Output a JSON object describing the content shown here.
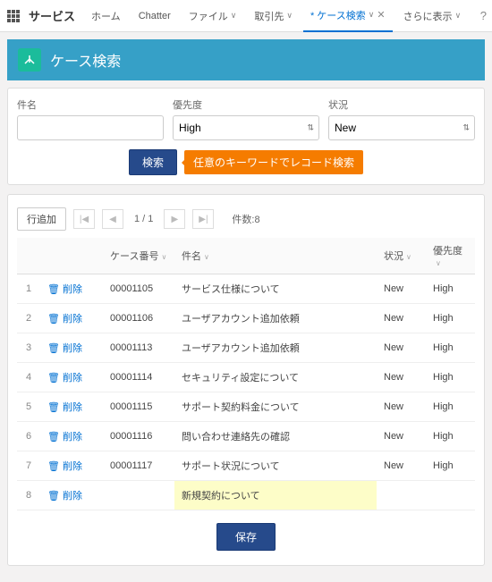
{
  "nav": {
    "app": "サービス",
    "items": [
      "ホーム",
      "Chatter",
      "ファイル",
      "取引先",
      "* ケース検索",
      "さらに表示"
    ],
    "dropdown_idx": [
      2,
      3,
      4,
      5
    ],
    "active_idx": 4
  },
  "header": {
    "title": "ケース検索",
    "icon_glyph": "⬍"
  },
  "filters": {
    "subject_label": "件名",
    "subject_value": "",
    "priority_label": "優先度",
    "priority_value": "High",
    "status_label": "状況",
    "status_value": "New"
  },
  "actions": {
    "search": "検索",
    "callout": "任意のキーワードでレコード検索",
    "add_row": "行追加",
    "save": "保存"
  },
  "pager": {
    "page_text": "1 / 1",
    "count_text": "件数:8"
  },
  "columns": {
    "case_no": "ケース番号",
    "subject": "件名",
    "status": "状況",
    "priority": "優先度"
  },
  "delete_label": "削除",
  "rows": [
    {
      "idx": "1",
      "case": "00001105",
      "subject": "サービス仕様について",
      "status": "New",
      "priority": "High"
    },
    {
      "idx": "2",
      "case": "00001106",
      "subject": "ユーザアカウント追加依頼",
      "status": "New",
      "priority": "High"
    },
    {
      "idx": "3",
      "case": "00001113",
      "subject": "ユーザアカウント追加依頼",
      "status": "New",
      "priority": "High"
    },
    {
      "idx": "4",
      "case": "00001114",
      "subject": "セキュリティ設定について",
      "status": "New",
      "priority": "High"
    },
    {
      "idx": "5",
      "case": "00001115",
      "subject": "サポート契約料金について",
      "status": "New",
      "priority": "High"
    },
    {
      "idx": "6",
      "case": "00001116",
      "subject": "問い合わせ連絡先の確認",
      "status": "New",
      "priority": "High"
    },
    {
      "idx": "7",
      "case": "00001117",
      "subject": "サポート状況について",
      "status": "New",
      "priority": "High"
    },
    {
      "idx": "8",
      "case": "",
      "subject": "新規契約について",
      "status": "",
      "priority": "",
      "highlight": true
    }
  ]
}
